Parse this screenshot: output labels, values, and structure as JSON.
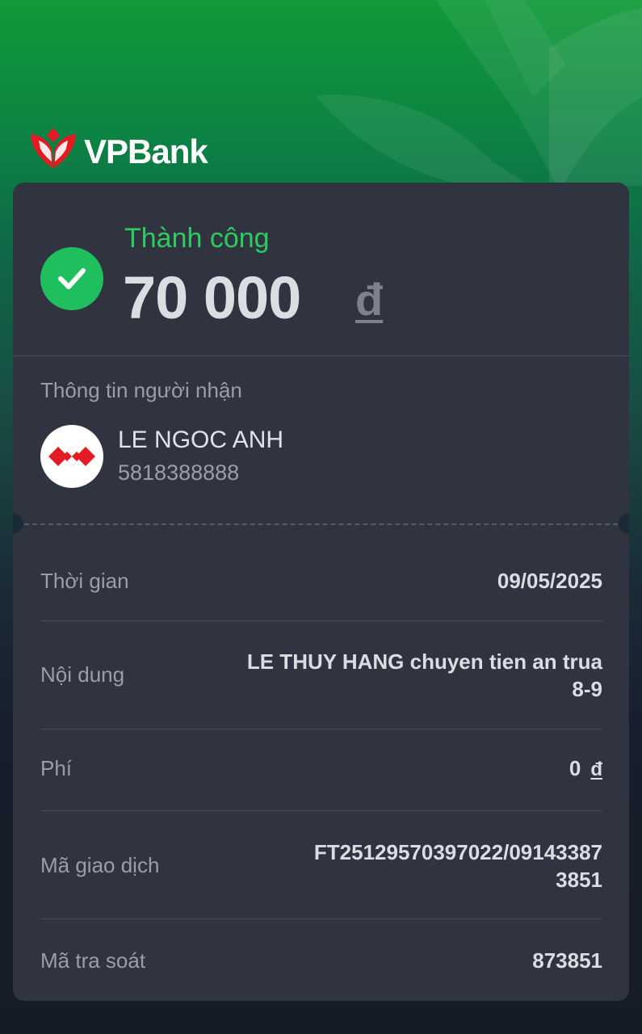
{
  "brand": {
    "name_main": "VPBan",
    "name_k": "k"
  },
  "transaction": {
    "status": "Thành công",
    "amount": "70 000",
    "currency": "đ"
  },
  "recipient": {
    "section_title": "Thông tin người nhận",
    "name": "LE NGOC ANH",
    "account": "5818388888",
    "bank_logo_icon": "techcombank-logo-icon"
  },
  "details": {
    "time_label": "Thời gian",
    "time_value": "09/05/2025",
    "content_label": "Nội dung",
    "content_value_line1": "LE THUY HANG chuyen tien an trua",
    "content_value_line2": "8-9",
    "fee_label": "Phí",
    "fee_value": "0",
    "fee_currency": "đ",
    "txn_id_label": "Mã giao dịch",
    "txn_id_line1": "FT25129570397022/09143387",
    "txn_id_line2": "3851",
    "trace_label": "Mã tra soát",
    "trace_value": "873851"
  },
  "colors": {
    "success": "#2ecc60",
    "card_bg": "#2f3440",
    "brand_red": "#e31b23"
  }
}
